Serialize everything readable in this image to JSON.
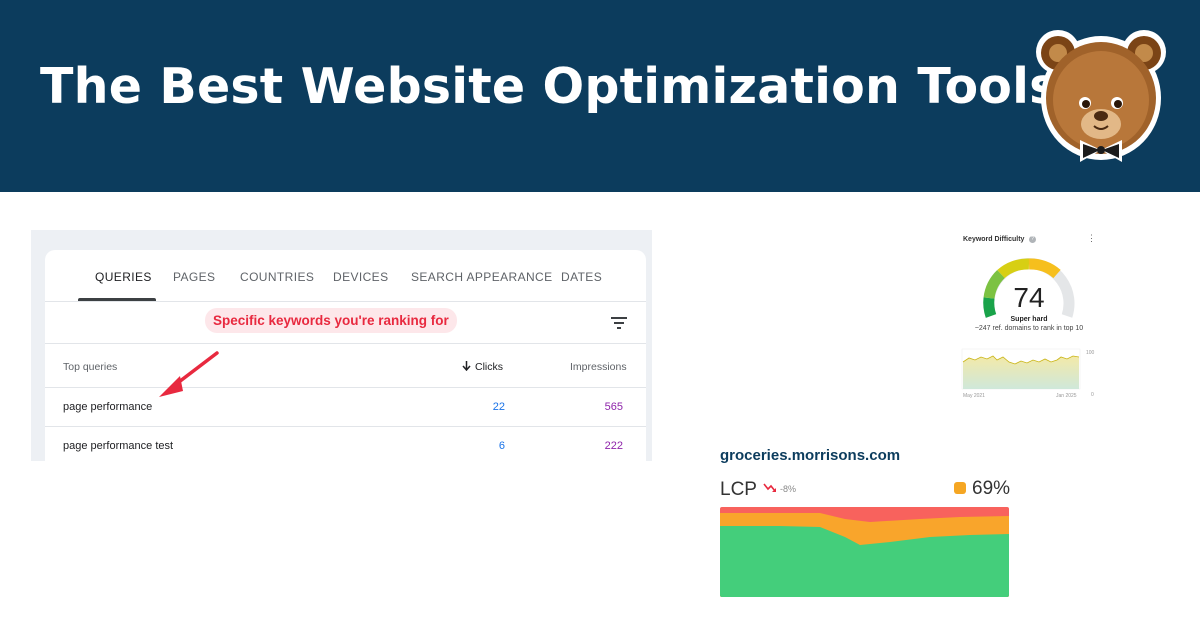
{
  "banner": {
    "title": "The Best Website Optimization Tools",
    "background": "#0c3c5d",
    "mascot_icon": "bear-with-bowtie-logo"
  },
  "search_console": {
    "tabs": [
      {
        "label": "QUERIES",
        "active": true
      },
      {
        "label": "PAGES",
        "active": false
      },
      {
        "label": "COUNTRIES",
        "active": false
      },
      {
        "label": "DEVICES",
        "active": false
      },
      {
        "label": "SEARCH APPEARANCE",
        "active": false
      },
      {
        "label": "DATES",
        "active": false
      }
    ],
    "annotation": "Specific keywords you're ranking for",
    "columns": {
      "query": "Top queries",
      "clicks": "Clicks",
      "impressions": "Impressions"
    },
    "rows": [
      {
        "query": "page performance",
        "clicks": "22",
        "impressions": "565"
      },
      {
        "query": "page performance test",
        "clicks": "6",
        "impressions": "222"
      }
    ],
    "colors": {
      "clicks": "#1a73e8",
      "impressions": "#8e24aa",
      "annotation": "#e8293f"
    }
  },
  "keyword_difficulty": {
    "title": "Keyword Difficulty",
    "value": "74",
    "label": "Super hard",
    "subtitle": "~247 ref. domains to rank in top 10",
    "axis": {
      "y_top": "100",
      "y_bottom": "0",
      "x_start": "May 2021",
      "x_end": "Jan 2025"
    }
  },
  "crux": {
    "domain": "groceries.morrisons.com",
    "metric": "LCP",
    "change": "-8%",
    "percent": "69%",
    "colors": {
      "good": "#44ce7b",
      "needs_improvement": "#f9a52b",
      "poor": "#f8625d"
    }
  }
}
